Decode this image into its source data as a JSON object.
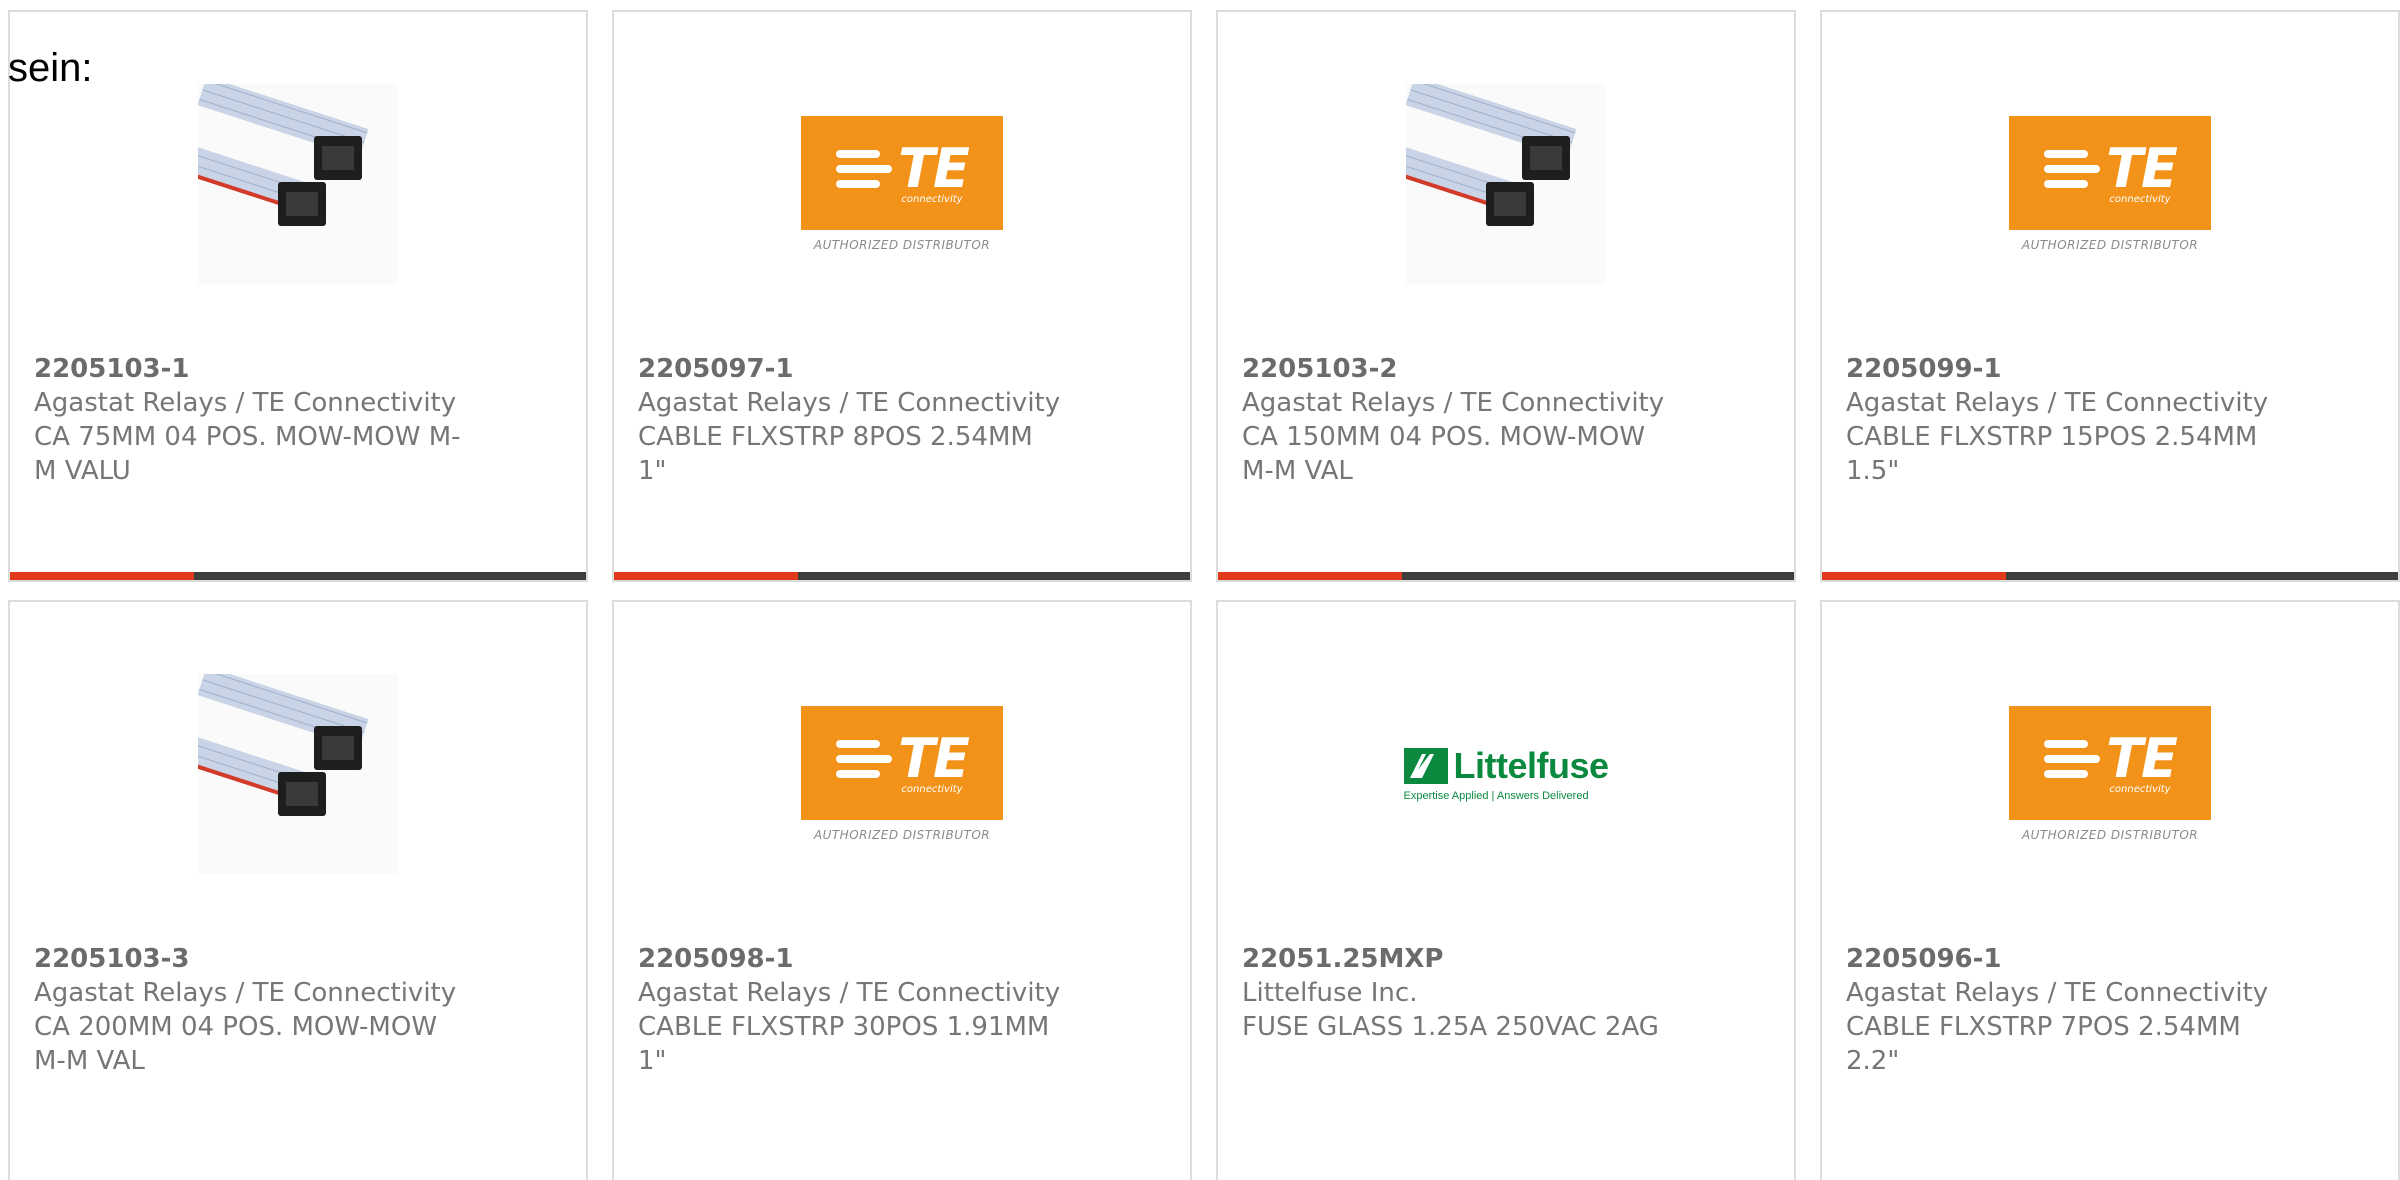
{
  "page": {
    "intro_text": "sein:"
  },
  "products": [
    {
      "part_number": "2205103-1",
      "manufacturer": "Agastat Relays / TE Connectivity",
      "description": "CA 75MM 04 POS. MOW-MOW M-M VALU",
      "image": "ribbon-cable",
      "progress_fraction": 0.32
    },
    {
      "part_number": "2205097-1",
      "manufacturer": "Agastat Relays / TE Connectivity",
      "description": "CABLE FLXSTRP 8POS 2.54MM 1\"",
      "image": "te-logo",
      "progress_fraction": 0.32
    },
    {
      "part_number": "2205103-2",
      "manufacturer": "Agastat Relays / TE Connectivity",
      "description": "CA 150MM 04 POS. MOW-MOW M-M VAL",
      "image": "ribbon-cable",
      "progress_fraction": 0.32
    },
    {
      "part_number": "2205099-1",
      "manufacturer": "Agastat Relays / TE Connectivity",
      "description": "CABLE FLXSTRP 15POS 2.54MM 1.5\"",
      "image": "te-logo",
      "progress_fraction": 0.32
    },
    {
      "part_number": "2205103-3",
      "manufacturer": "Agastat Relays / TE Connectivity",
      "description": "CA 200MM 04 POS. MOW-MOW M-M VAL",
      "image": "ribbon-cable"
    },
    {
      "part_number": "2205098-1",
      "manufacturer": "Agastat Relays / TE Connectivity",
      "description": "CABLE FLXSTRP 30POS 1.91MM 1\"",
      "image": "te-logo"
    },
    {
      "part_number": "22051.25MXP",
      "manufacturer": "Littelfuse Inc.",
      "description": "FUSE GLASS 1.25A 250VAC 2AG",
      "image": "littelfuse-logo"
    },
    {
      "part_number": "2205096-1",
      "manufacturer": "Agastat Relays / TE Connectivity",
      "description": "CABLE FLXSTRP 7POS 2.54MM 2.2\"",
      "image": "te-logo"
    }
  ],
  "logos": {
    "te": {
      "word": "TE",
      "sub": "connectivity",
      "tagline": "AUTHORIZED DISTRIBUTOR"
    },
    "littelfuse": {
      "word": "Littelfuse",
      "tagline": "Expertise Applied | Answers Delivered"
    }
  },
  "colors": {
    "te_orange": "#f39219",
    "littelfuse_green": "#0b8a3f",
    "progress_fill": "#e2391a",
    "progress_track": "#3e3e3e",
    "card_border": "#dcdcdc"
  }
}
